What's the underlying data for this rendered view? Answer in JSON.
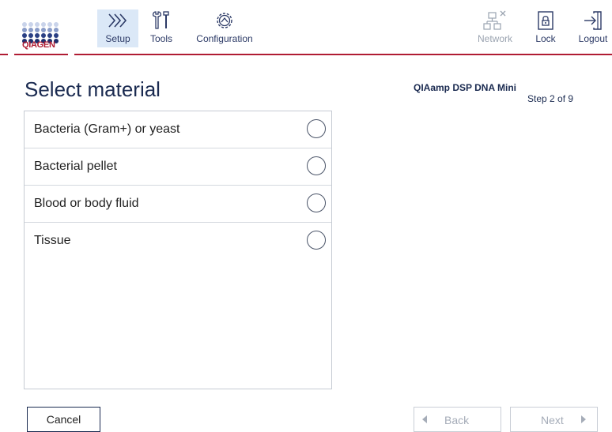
{
  "brand": {
    "name": "QIAGEN",
    "accent_color": "#b01c33",
    "icon": "qiagen-logo-icon"
  },
  "header": {
    "nav": [
      {
        "label": "Setup",
        "icon": "setup-chevrons-icon",
        "active": true
      },
      {
        "label": "Tools",
        "icon": "tools-icon",
        "active": false
      },
      {
        "label": "Configuration",
        "icon": "configuration-gear-icon",
        "active": false
      }
    ],
    "right": [
      {
        "label": "Network",
        "icon": "network-icon",
        "enabled": false
      },
      {
        "label": "Lock",
        "icon": "lock-icon",
        "enabled": true
      },
      {
        "label": "Logout",
        "icon": "logout-icon",
        "enabled": true
      }
    ]
  },
  "main": {
    "title": "Select material",
    "protocol": "QIAamp DSP DNA Mini",
    "step": "Step 2 of 9",
    "materials": [
      {
        "label": "Bacteria (Gram+) or yeast",
        "selected": false
      },
      {
        "label": "Bacterial pellet",
        "selected": false
      },
      {
        "label": "Blood or body fluid",
        "selected": false
      },
      {
        "label": "Tissue",
        "selected": false
      }
    ]
  },
  "footer": {
    "cancel_label": "Cancel",
    "back_label": "Back",
    "next_label": "Next"
  }
}
